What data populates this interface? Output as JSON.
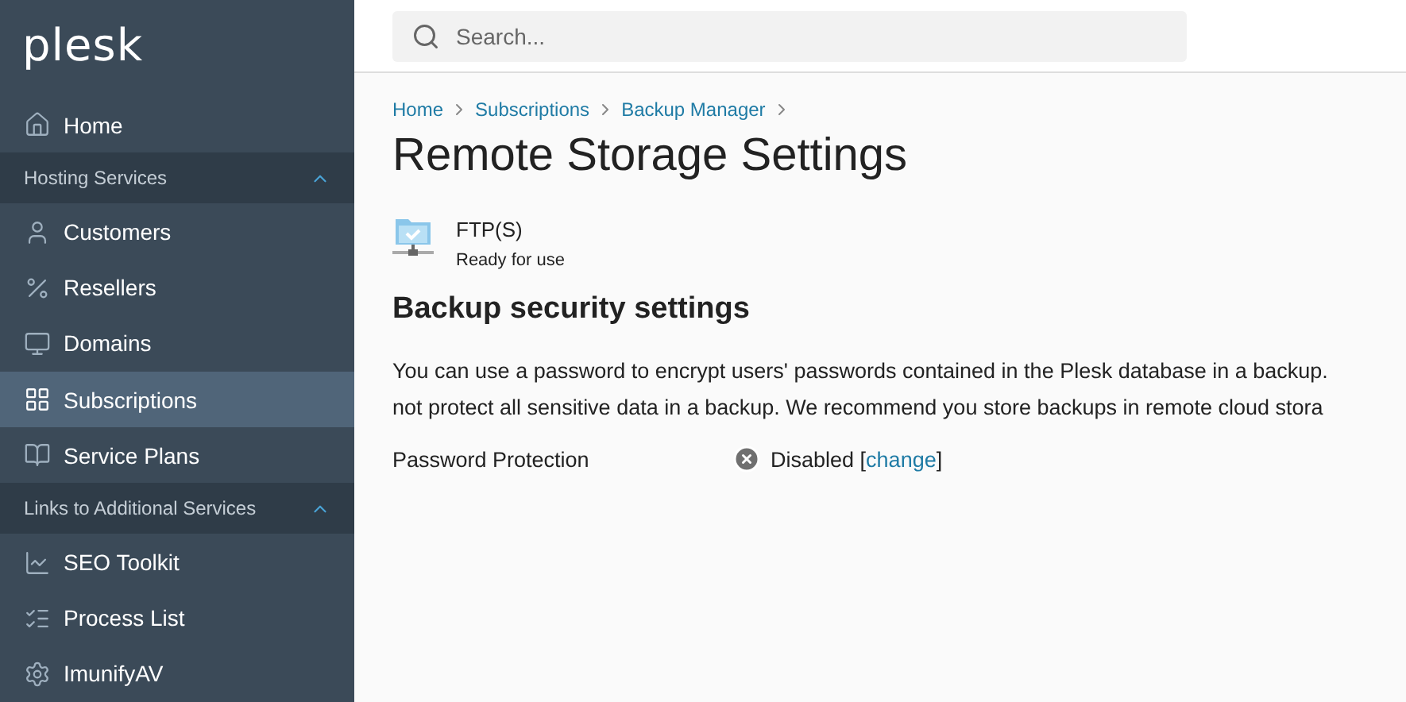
{
  "sidebar": {
    "logo": "plesk",
    "items": [
      {
        "kind": "item",
        "label": "Home",
        "selected": false
      },
      {
        "kind": "group",
        "label": "Hosting Services",
        "expanded": true,
        "children": [
          {
            "kind": "item",
            "label": "Customers",
            "selected": false
          },
          {
            "kind": "item",
            "label": "Resellers",
            "selected": false
          },
          {
            "kind": "item",
            "label": "Domains",
            "selected": false
          },
          {
            "kind": "item",
            "label": "Subscriptions",
            "selected": true
          },
          {
            "kind": "item",
            "label": "Service Plans",
            "selected": false
          }
        ]
      },
      {
        "kind": "group",
        "label": "Links to Additional Services",
        "expanded": true,
        "children": [
          {
            "kind": "item",
            "label": "SEO Toolkit",
            "selected": false
          },
          {
            "kind": "item",
            "label": "Process List",
            "selected": false
          },
          {
            "kind": "item",
            "label": "ImunifyAV",
            "selected": false
          }
        ]
      }
    ]
  },
  "search": {
    "placeholder": "Search..."
  },
  "breadcrumbs": [
    "Home",
    "Subscriptions",
    "Backup Manager"
  ],
  "page_title": "Remote Storage Settings",
  "storage": {
    "name": "FTP(S)",
    "status": "Ready for use"
  },
  "section_title": "Backup security settings",
  "description": [
    "You can use a password to encrypt users' passwords contained in the Plesk database in a backup.",
    "not protect all sensitive data in a backup. We recommend you store backups in remote cloud stora"
  ],
  "password_protection": {
    "label": "Password Protection",
    "enabled": false,
    "status": "Disabled [",
    "link": "change",
    "status_end": "]"
  }
}
